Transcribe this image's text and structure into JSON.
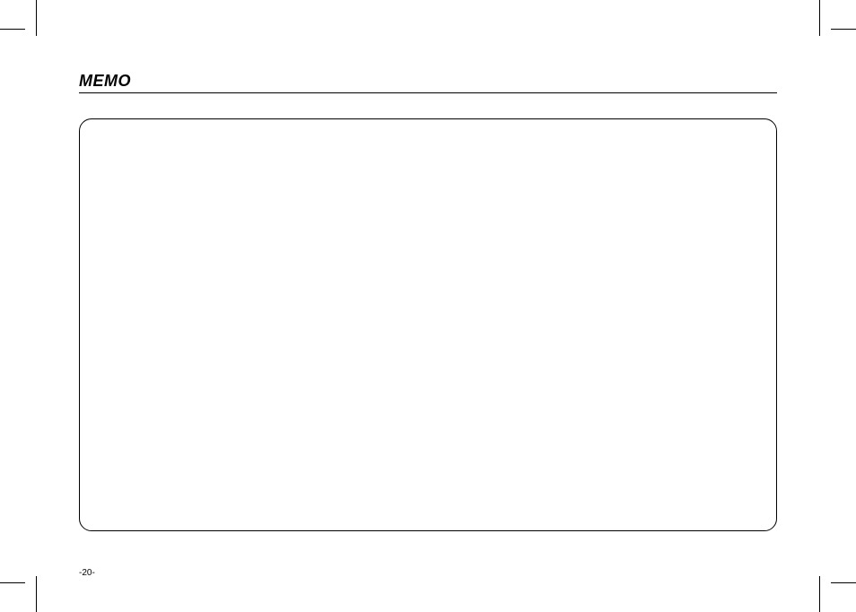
{
  "header": {
    "title": "MEMO"
  },
  "footer": {
    "page_number": "-20-"
  }
}
